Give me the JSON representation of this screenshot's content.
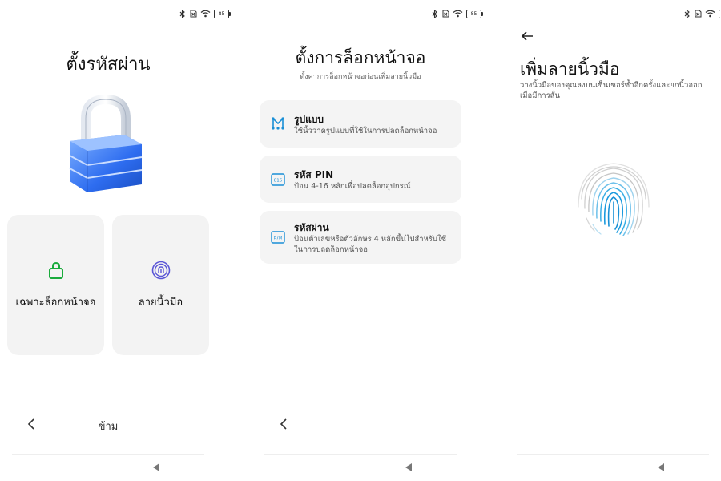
{
  "status": {
    "battery": "85"
  },
  "screen1": {
    "title": "ตั้งรหัสผ่าน",
    "options": [
      {
        "label": "เฉพาะล็อกหน้าจอ",
        "icon": "lock-icon",
        "color": "#1aab3c"
      },
      {
        "label": "ลายนิ้วมือ",
        "icon": "fingerprint-icon",
        "color": "#5a55d6"
      }
    ],
    "skip_label": "ข้าม"
  },
  "screen2": {
    "title": "ตั้งการล็อกหน้าจอ",
    "subtitle": "ตั้งค่าการล็อกหน้าจอก่อนเพิ่มลายนิ้วมือ",
    "methods": [
      {
        "title": "รูปแบบ",
        "desc": "ใช้นิ้ววาดรูปแบบที่ใช้ในการปลดล็อกหน้าจอ",
        "icon": "pattern-icon"
      },
      {
        "title": "รหัส PIN",
        "desc": "ป้อน 4-16 หลักเพื่อปลดล็อกอุปกรณ์",
        "icon": "pin-icon",
        "icon_text": "816"
      },
      {
        "title": "รหัสผ่าน",
        "desc": "ป้อนตัวเลขหรือตัวอักษร 4 หลักขึ้นไปสำหรับใช้ในการปลดล็อกหน้าจอ",
        "icon": "password-icon",
        "icon_text": "Þ7M"
      }
    ]
  },
  "screen3": {
    "title": "เพิ่มลายนิ้วมือ",
    "subtitle": "วางนิ้วมือของคุณลงบนเซ็นเซอร์ซ้ำอีกครั้งและยกนิ้วออกเมื่อมีการสั่น"
  },
  "colors": {
    "accent": "#1a8fd6",
    "card": "#f4f4f4"
  }
}
